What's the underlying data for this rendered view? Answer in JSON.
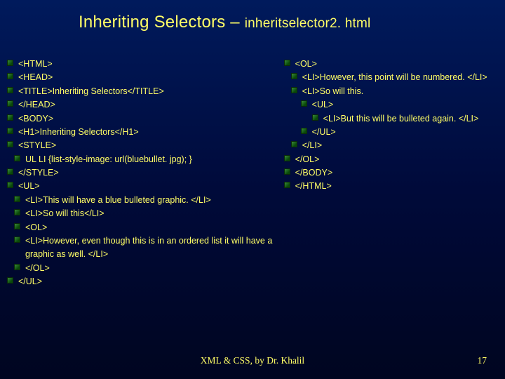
{
  "title_main": "Inheriting Selectors – ",
  "title_sub": "inheritselector2. html",
  "left_lines": [
    {
      "depth": 1,
      "text": "<HTML>"
    },
    {
      "depth": 1,
      "text": "<HEAD>"
    },
    {
      "depth": 1,
      "text": "<TITLE>Inheriting Selectors</TITLE>"
    },
    {
      "depth": 1,
      "text": "</HEAD>"
    },
    {
      "depth": 1,
      "text": "<BODY>"
    },
    {
      "depth": 1,
      "text": "<H1>Inheriting Selectors</H1>"
    },
    {
      "depth": 1,
      "text": "<STYLE>"
    },
    {
      "depth": 2,
      "text": "UL LI {list-style-image: url(bluebullet. jpg); }"
    },
    {
      "depth": 1,
      "text": "</STYLE>"
    },
    {
      "depth": 1,
      "text": "<UL>"
    },
    {
      "depth": 2,
      "text": "<LI>This will have a blue bulleted graphic. </LI>"
    },
    {
      "depth": 2,
      "text": "<LI>So will this</LI>"
    },
    {
      "depth": 2,
      "text": "<OL>"
    },
    {
      "depth": 2,
      "text": "<LI>However, even though this is in an ordered list it will have a graphic as well. </LI>"
    },
    {
      "depth": 2,
      "text": "</OL>"
    },
    {
      "depth": 1,
      "text": "</UL>"
    }
  ],
  "right_lines": [
    {
      "depth": 1,
      "text": "<OL>"
    },
    {
      "depth": 2,
      "text": "<LI>However, this point will be numbered. </LI>"
    },
    {
      "depth": 2,
      "text": "<LI>So will this."
    },
    {
      "depth": 3,
      "text": "<UL>"
    },
    {
      "depth": 4,
      "text": "<LI>But this will be bulleted again. </LI>"
    },
    {
      "depth": 3,
      "text": "</UL>"
    },
    {
      "depth": 2,
      "text": "</LI>"
    },
    {
      "depth": 1,
      "text": "</OL>"
    },
    {
      "depth": 1,
      "text": "</BODY>"
    },
    {
      "depth": 1,
      "text": "</HTML>"
    }
  ],
  "footer": "XML & CSS, by Dr. Khalil",
  "page_number": "17"
}
